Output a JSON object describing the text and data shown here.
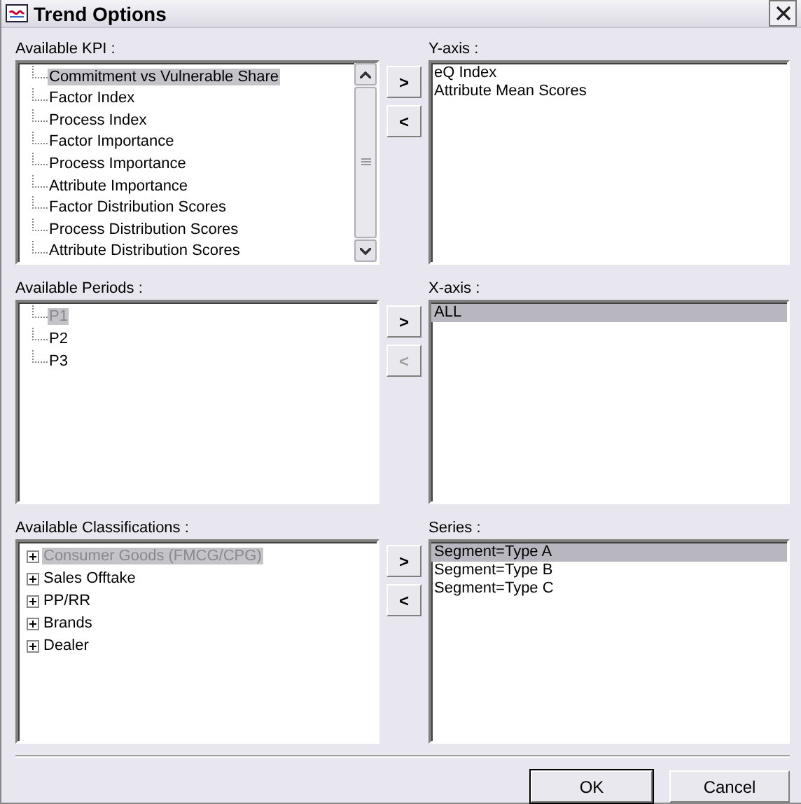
{
  "window": {
    "title": "Trend Options"
  },
  "sections": [
    {
      "source": {
        "label": "Available KPI :",
        "kind": "lines",
        "scrollbar": true,
        "items": [
          {
            "label": "Commitment vs Vulnerable Share",
            "selected": true,
            "disabled": false
          },
          {
            "label": "Factor Index",
            "selected": false,
            "disabled": false
          },
          {
            "label": "Process Index",
            "selected": false,
            "disabled": false
          },
          {
            "label": "Factor Importance",
            "selected": false,
            "disabled": false
          },
          {
            "label": "Process Importance",
            "selected": false,
            "disabled": false
          },
          {
            "label": "Attribute Importance",
            "selected": false,
            "disabled": false
          },
          {
            "label": "Factor Distribution Scores",
            "selected": false,
            "disabled": false
          },
          {
            "label": "Process Distribution Scores",
            "selected": false,
            "disabled": false
          },
          {
            "label": "Attribute Distribution Scores",
            "selected": false,
            "disabled": false
          }
        ]
      },
      "add": {
        "label": ">",
        "disabled": false
      },
      "remove": {
        "label": "<",
        "disabled": false
      },
      "target": {
        "label": "Y-axis :",
        "items": [
          {
            "label": "eQ Index",
            "selected": false
          },
          {
            "label": "Attribute Mean Scores",
            "selected": false
          }
        ]
      }
    },
    {
      "source": {
        "label": "Available Periods :",
        "kind": "lines",
        "scrollbar": false,
        "items": [
          {
            "label": "P1",
            "selected": true,
            "disabled": true
          },
          {
            "label": "P2",
            "selected": false,
            "disabled": false
          },
          {
            "label": "P3",
            "selected": false,
            "disabled": false
          }
        ]
      },
      "add": {
        "label": ">",
        "disabled": false
      },
      "remove": {
        "label": "<",
        "disabled": true
      },
      "target": {
        "label": "X-axis :",
        "items": [
          {
            "label": "ALL",
            "selected": true
          }
        ]
      }
    },
    {
      "source": {
        "label": "Available Classifications :",
        "kind": "expanders",
        "scrollbar": false,
        "items": [
          {
            "label": "Consumer Goods (FMCG/CPG)",
            "selected": true,
            "disabled": true
          },
          {
            "label": "Sales Offtake",
            "selected": false,
            "disabled": false
          },
          {
            "label": "PP/RR",
            "selected": false,
            "disabled": false
          },
          {
            "label": "Brands",
            "selected": false,
            "disabled": false
          },
          {
            "label": "Dealer",
            "selected": false,
            "disabled": false
          }
        ]
      },
      "add": {
        "label": ">",
        "disabled": false
      },
      "remove": {
        "label": "<",
        "disabled": false
      },
      "target": {
        "label": "Series :",
        "items": [
          {
            "label": "Segment=Type A",
            "selected": true
          },
          {
            "label": "Segment=Type B",
            "selected": false
          },
          {
            "label": "Segment=Type C",
            "selected": false
          }
        ]
      }
    }
  ],
  "buttons": [
    {
      "label": "OK",
      "default": true
    },
    {
      "label": "Cancel",
      "default": false
    }
  ]
}
